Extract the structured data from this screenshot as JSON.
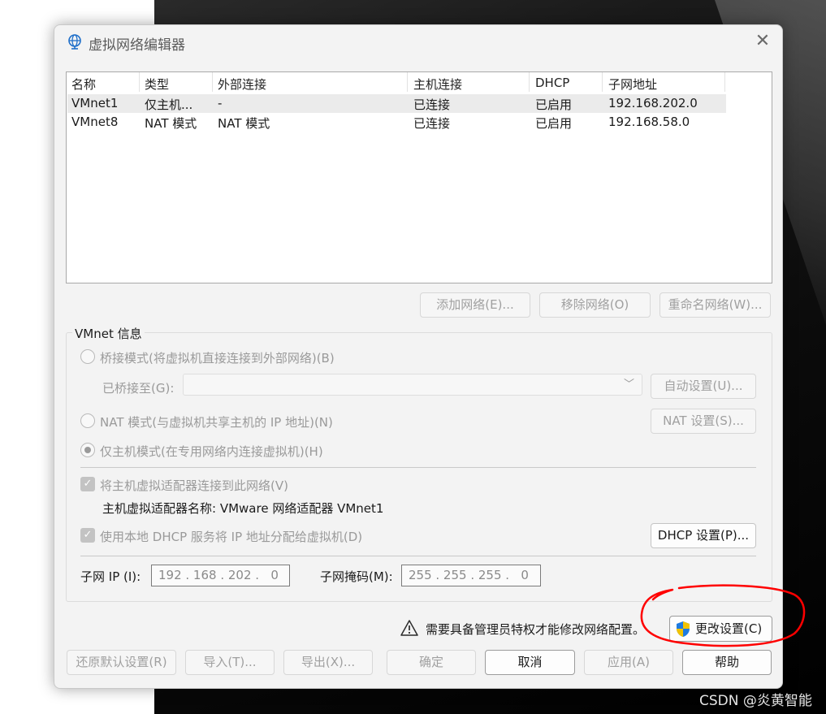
{
  "window": {
    "title": "虚拟网络编辑器"
  },
  "network_table": {
    "columns": [
      "名称",
      "类型",
      "外部连接",
      "主机连接",
      "DHCP",
      "子网地址"
    ],
    "rows": [
      [
        "VMnet1",
        "仅主机...",
        "-",
        "已连接",
        "已启用",
        "192.168.202.0"
      ],
      [
        "VMnet8",
        "NAT 模式",
        "NAT 模式",
        "已连接",
        "已启用",
        "192.168.58.0"
      ]
    ]
  },
  "list_buttons": {
    "add": "添加网络(E)...",
    "remove": "移除网络(O)",
    "rename": "重命名网络(W)..."
  },
  "vmnet_info": {
    "title": "VMnet 信息",
    "bridge_mode": "桥接模式(将虚拟机直接连接到外部网络)(B)",
    "bridged_to_label": "已桥接至(G):",
    "auto_settings": "自动设置(U)...",
    "nat_mode": "NAT 模式(与虚拟机共享主机的 IP 地址)(N)",
    "nat_settings": "NAT 设置(S)...",
    "host_only_mode": "仅主机模式(在专用网络内连接虚拟机)(H)",
    "connect_adapter": "将主机虚拟适配器连接到此网络(V)",
    "adapter_name": "主机虚拟适配器名称: VMware 网络适配器 VMnet1",
    "use_dhcp": "使用本地 DHCP 服务将 IP 地址分配给虚拟机(D)",
    "dhcp_settings": "DHCP 设置(P)...",
    "subnet_ip_label": "子网 IP (I):",
    "subnet_ip_value": "192 . 168 . 202 .   0",
    "subnet_mask_label": "子网掩码(M):",
    "subnet_mask_value": "255 . 255 . 255 .   0"
  },
  "admin_notice": {
    "text": "需要具备管理员特权才能修改网络配置。",
    "change_settings": "更改设置(C)"
  },
  "footer_buttons": {
    "restore_defaults": "还原默认设置(R)",
    "import": "导入(T)...",
    "export": "导出(X)...",
    "ok": "确定",
    "cancel": "取消",
    "apply": "应用(A)",
    "help": "帮助"
  },
  "watermark": "CSDN @炎黄智能",
  "colors": {
    "annotation_red": "#ff0000",
    "shield_blue": "#1f7be0",
    "shield_yellow": "#f2c300"
  }
}
